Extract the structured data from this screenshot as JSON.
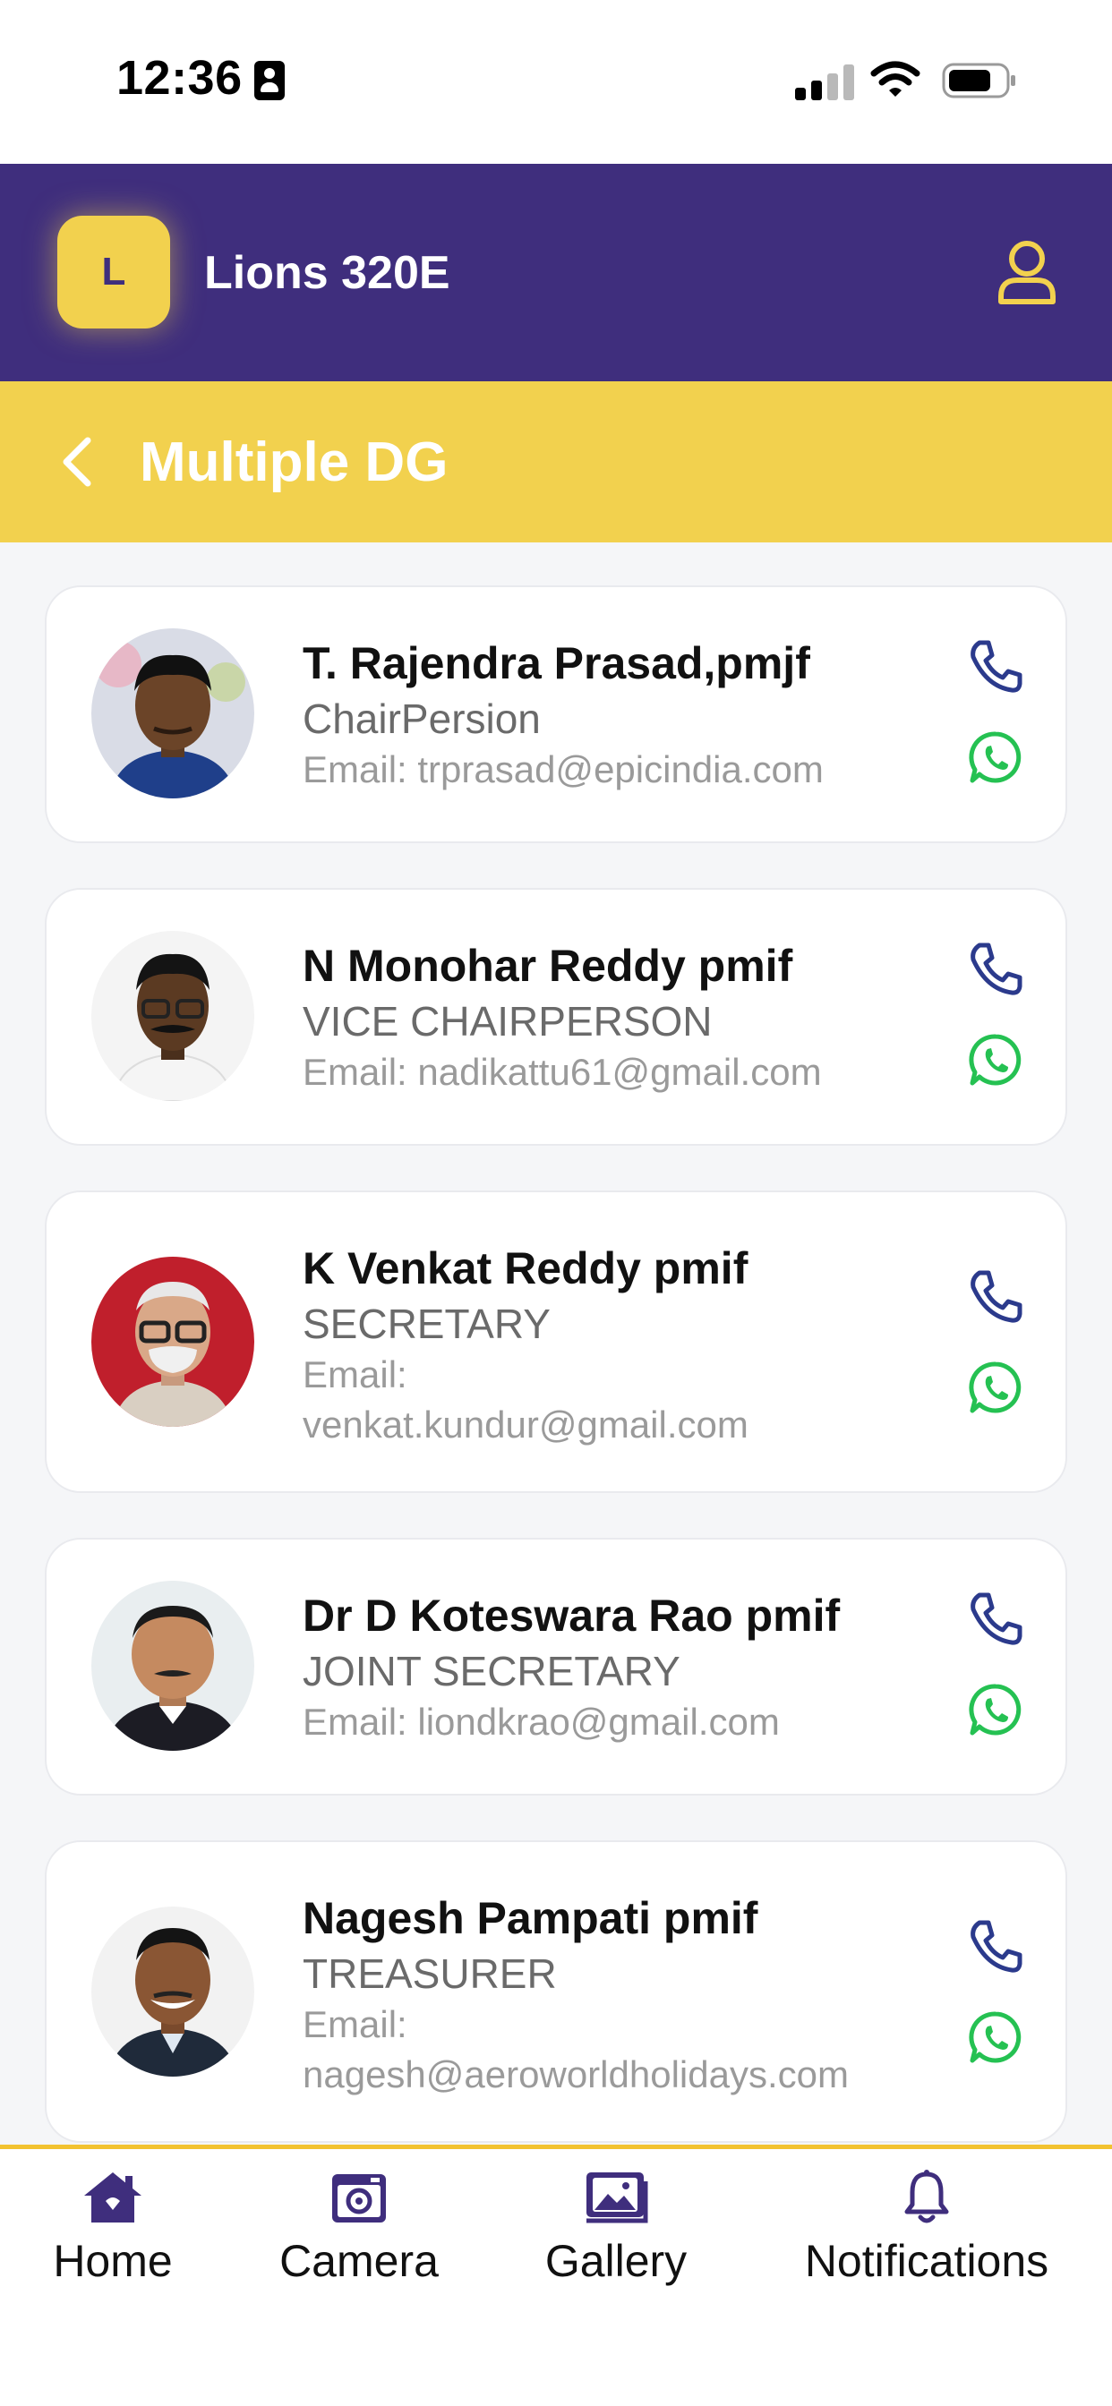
{
  "status_bar": {
    "time": "12:36"
  },
  "header": {
    "logo_letter": "L",
    "app_title": "Lions 320E"
  },
  "page": {
    "title": "Multiple DG"
  },
  "members": [
    {
      "name": "T. Rajendra Prasad,pmjf",
      "role": "ChairPersion",
      "email_label": "Email: trprasad@epicindia.com"
    },
    {
      "name": "N Monohar Reddy pmif",
      "role": "VICE CHAIRPERSON",
      "email_label": "Email: nadikattu61@gmail.com"
    },
    {
      "name": "K Venkat Reddy pmif",
      "role": "SECRETARY",
      "email_prefix": "Email:",
      "email": "venkat.kundur@gmail.com"
    },
    {
      "name": "Dr D Koteswara Rao pmif",
      "role": "JOINT SECRETARY",
      "email_label": "Email: liondkrao@gmail.com"
    },
    {
      "name": "Nagesh Pampati pmif",
      "role": "TREASURER",
      "email_prefix": "Email:",
      "email": "nagesh@aeroworldholidays.com"
    }
  ],
  "nav": {
    "home": "Home",
    "camera": "Camera",
    "gallery": "Gallery",
    "notifications": "Notifications"
  },
  "colors": {
    "header_purple": "#3f2e7d",
    "accent_yellow": "#f2d14e",
    "call_blue": "#2b3a8c",
    "whatsapp_green": "#25c152"
  }
}
